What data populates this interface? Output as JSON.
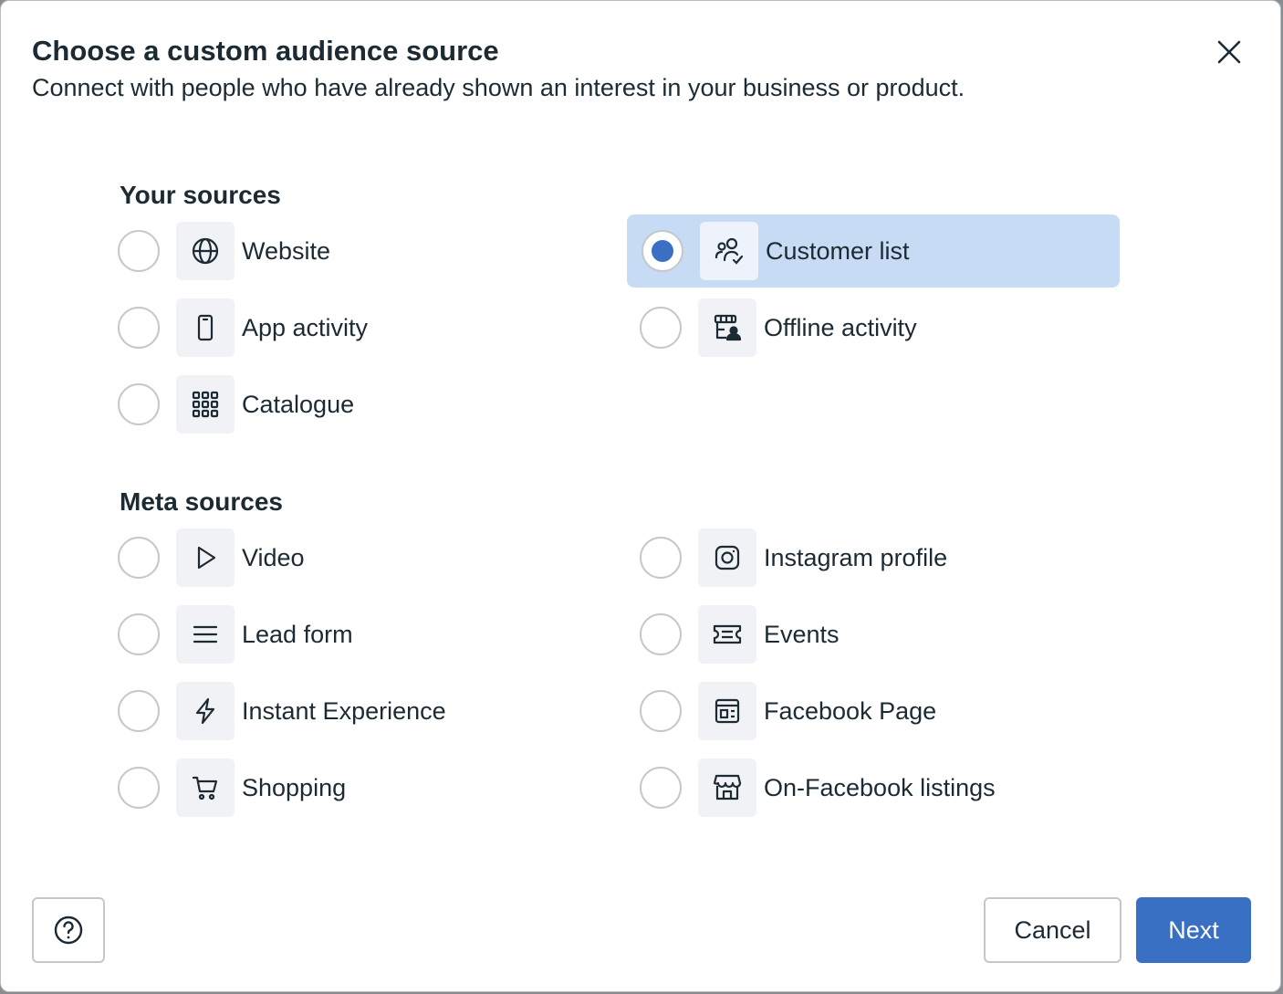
{
  "dialog": {
    "title": "Choose a custom audience source",
    "subtitle": "Connect with people who have already shown an interest in your business or product."
  },
  "your_sources": {
    "heading": "Your sources",
    "options": [
      {
        "label": "Website",
        "icon": "globe-icon",
        "selected": false
      },
      {
        "label": "Customer list",
        "icon": "customer-list-icon",
        "selected": true
      },
      {
        "label": "App activity",
        "icon": "mobile-phone-icon",
        "selected": false
      },
      {
        "label": "Offline activity",
        "icon": "offline-store-icon",
        "selected": false
      },
      {
        "label": "Catalogue",
        "icon": "grid-icon",
        "selected": false
      }
    ]
  },
  "meta_sources": {
    "heading": "Meta sources",
    "options": [
      {
        "label": "Video",
        "icon": "play-icon",
        "selected": false
      },
      {
        "label": "Instagram profile",
        "icon": "instagram-icon",
        "selected": false
      },
      {
        "label": "Lead form",
        "icon": "menu-lines-icon",
        "selected": false
      },
      {
        "label": "Events",
        "icon": "ticket-icon",
        "selected": false
      },
      {
        "label": "Instant Experience",
        "icon": "lightning-icon",
        "selected": false
      },
      {
        "label": "Facebook Page",
        "icon": "page-icon",
        "selected": false
      },
      {
        "label": "Shopping",
        "icon": "cart-icon",
        "selected": false
      },
      {
        "label": "On-Facebook listings",
        "icon": "storefront-icon",
        "selected": false
      }
    ]
  },
  "footer": {
    "help_icon": "question-circle-icon",
    "cancel_label": "Cancel",
    "next_label": "Next"
  },
  "colors": {
    "accent": "#3a70c4",
    "selected_bg": "#c7dbf4",
    "text": "#1c2b33"
  }
}
